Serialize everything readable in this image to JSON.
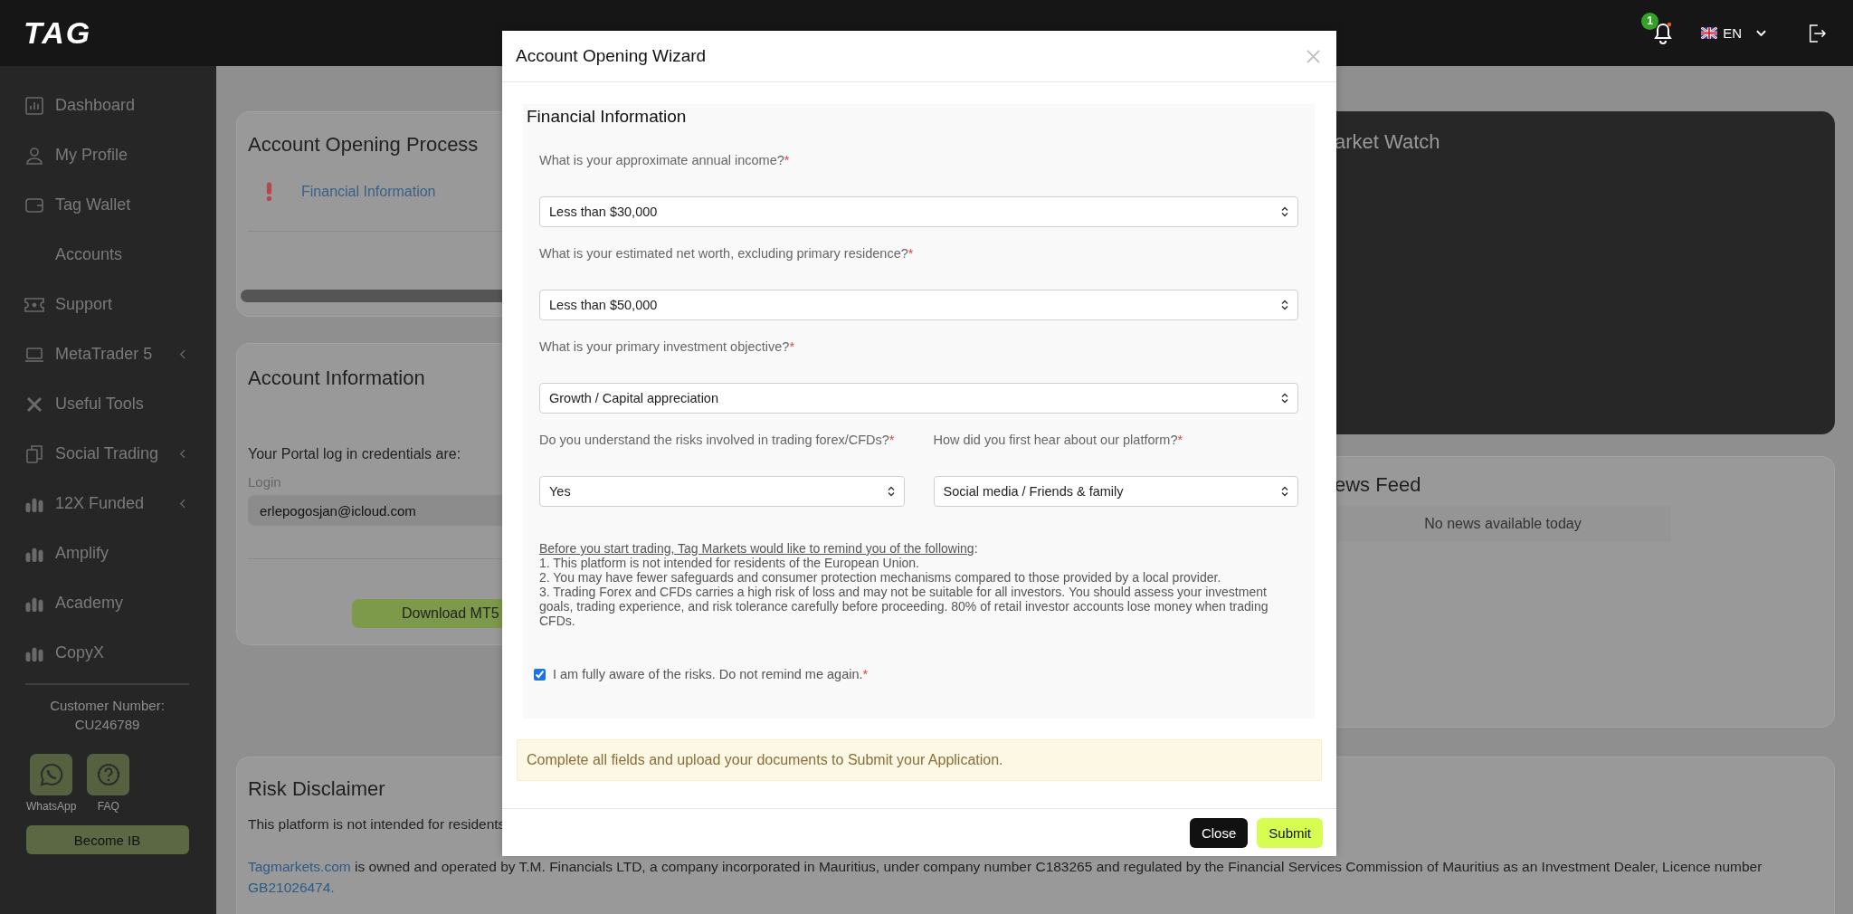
{
  "header": {
    "logo": "TAG",
    "notifications": {
      "count": "1"
    },
    "language": {
      "code": "EN"
    }
  },
  "sidebar": {
    "items": [
      {
        "label": "Dashboard",
        "submenu": false
      },
      {
        "label": "My Profile",
        "submenu": false
      },
      {
        "label": "Tag Wallet",
        "submenu": false
      },
      {
        "label": "Accounts",
        "submenu": false
      },
      {
        "label": "Support",
        "submenu": false
      },
      {
        "label": "MetaTrader 5",
        "submenu": true
      },
      {
        "label": "Useful Tools",
        "submenu": false
      },
      {
        "label": "Social Trading",
        "submenu": true
      },
      {
        "label": "12X Funded",
        "submenu": true
      },
      {
        "label": "Amplify",
        "submenu": false
      },
      {
        "label": "Academy",
        "submenu": false
      },
      {
        "label": "CopyX",
        "submenu": false
      }
    ],
    "customer_number": {
      "label": "Customer Number:",
      "value": "CU246789"
    },
    "quick_links": [
      {
        "label": "WhatsApp"
      },
      {
        "label": "FAQ"
      }
    ],
    "become_ib": "Become IB"
  },
  "page": {
    "account_opening_process": {
      "title": "Account Opening Process",
      "steps": [
        {
          "label": "Financial Information",
          "complete": false
        }
      ]
    },
    "account_information": {
      "title": "Account Information",
      "intro": "Your Portal log in credentials are:",
      "login": {
        "label": "Login",
        "value": "erlepogosjan@icloud.com"
      },
      "download_button": "Download MT5"
    },
    "market_watch": {
      "title": "arket Watch"
    },
    "news_feed": {
      "title": "ews Feed",
      "empty": "No news available today"
    },
    "risk_disclaimer": {
      "title": "Risk Disclaimer",
      "paragraphs": [
        {
          "kind": "plain",
          "text": "This platform is not intended for residents"
        },
        {
          "kind": "linked",
          "link": "Tagmarkets.com",
          "text": " is owned and operated by T.M. Financials LTD, a company incorporated in Mauritius, under company number C183265 and regulated by the Financial Services Commission of Mauritius as an Investment Dealer, Licence number ",
          "link_end": "GB21026474."
        }
      ]
    }
  },
  "modal": {
    "title": "Account Opening Wizard",
    "required_mark": "*",
    "section": {
      "title": "Financial Information",
      "rows": [
        [
          {
            "label": "What is your approximate annual income?",
            "required": true,
            "value": "Less than $30,000"
          }
        ],
        [
          {
            "label": "What is your estimated net worth, excluding primary residence?",
            "required": true,
            "value": "Less than $50,000"
          }
        ],
        [
          {
            "label": "What is your primary investment objective?",
            "required": true,
            "value": "Growth / Capital appreciation"
          }
        ],
        [
          {
            "label": "Do you understand the risks involved in trading forex/CFDs?",
            "required": true,
            "value": "Yes"
          },
          {
            "label": "How did you first hear about our platform?",
            "required": true,
            "value": "Social media / Friends & family"
          }
        ]
      ],
      "reminder": {
        "heading": "Before you start trading, Tag Markets would like to remind you of the following",
        "heading_end": ":",
        "points": [
          "1. This platform is not intended for residents of the European Union.",
          "2. You may have fewer safeguards and consumer protection mechanisms compared to those provided by a local provider.",
          "3. Trading Forex and CFDs carries a high risk of loss and may not be suitable for all investors. You should assess your investment goals, trading experience, and risk tolerance carefully before proceeding. 80% of retail investor accounts lose money when trading CFDs."
        ]
      },
      "acknowledge": {
        "label": "I am fully aware of the risks. Do not remind me again.",
        "required": true,
        "checked": true
      }
    },
    "alert": "Complete all fields and upload your documents to Submit your Application.",
    "buttons": [
      {
        "label": "Close",
        "kind": "secondary"
      },
      {
        "label": "Submit",
        "kind": "primary"
      }
    ]
  }
}
